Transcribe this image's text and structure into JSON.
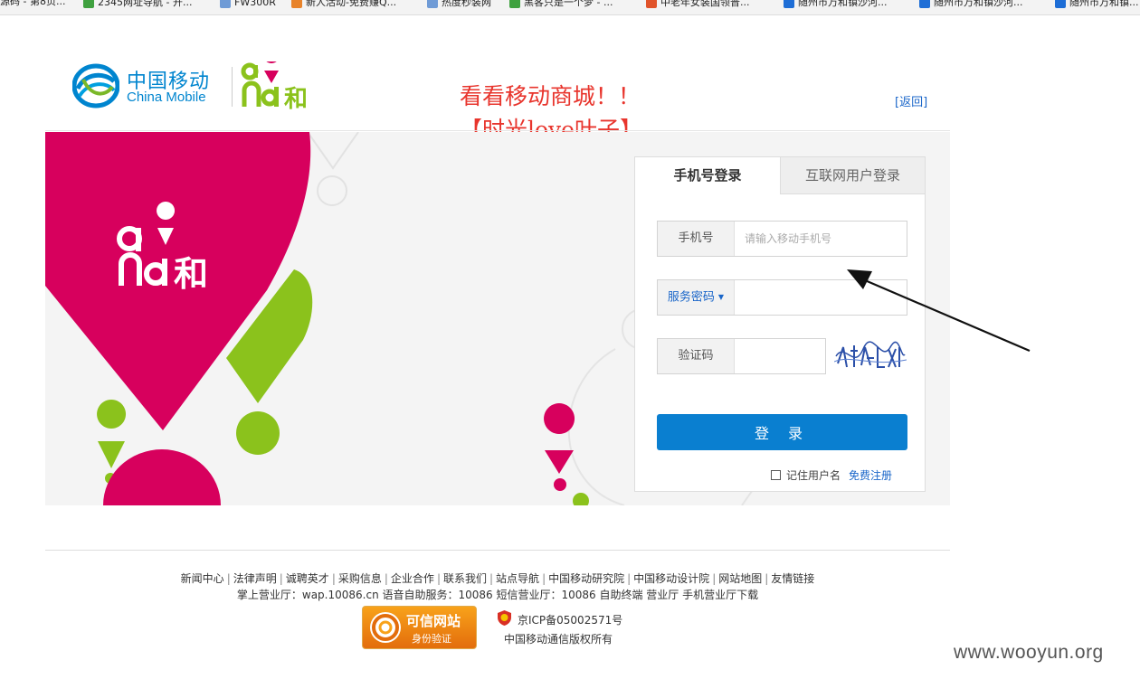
{
  "bookmarks": [
    {
      "label": "源码 - 第8页...",
      "icon_color": "#c8c8c8",
      "icon": "page-icon"
    },
    {
      "label": "2345网址导航 - 开...",
      "icon_color": "#3fa13f",
      "icon": "globe-icon"
    },
    {
      "label": "FW300R",
      "icon_color": "#6f9bd6",
      "icon": "ie-icon"
    },
    {
      "label": "新人活动-免费赚Q...",
      "icon_color": "#e8832a",
      "icon": "b-icon"
    },
    {
      "label": "热度秒装网",
      "icon_color": "#6f9bd6",
      "icon": "ie-icon"
    },
    {
      "label": "黑客只是一个梦 - ...",
      "icon_color": "#3fa13f",
      "icon": "s-icon"
    },
    {
      "label": "中老年女装国领普...",
      "icon_color": "#e0532a",
      "icon": "tao-icon"
    },
    {
      "label": "随州市万和镇沙河...",
      "icon_color": "#1e6ed6",
      "icon": "play-icon"
    },
    {
      "label": "随州市万和镇沙河...",
      "icon_color": "#1e6ed6",
      "icon": "play-icon"
    },
    {
      "label": "随州市万和镇...",
      "icon_color": "#1e6ed6",
      "icon": "play-icon"
    }
  ],
  "header": {
    "logo_cn": "中国移动",
    "logo_en": "China Mobile",
    "logo_and": "和",
    "promo_line1": "看看移动商城！！",
    "promo_line2": "【时光love叶子】",
    "return_link": "[返回]"
  },
  "banner": {
    "brand_text": "和",
    "colors": {
      "magenta": "#d7005d",
      "green": "#8bc21c",
      "bg": "#f4f4f4"
    }
  },
  "login": {
    "tab_phone": "手机号登录",
    "tab_internet": "互联网用户登录",
    "phone_label": "手机号",
    "phone_placeholder": "请输入移动手机号",
    "password_label": "服务密码",
    "password_caret": "▼",
    "captcha_label": "验证码",
    "submit": "登 录",
    "remember": "记住用户名",
    "register": "免费注册",
    "accent": "#0a7fd0"
  },
  "footer": {
    "links": [
      "新闻中心",
      "法律声明",
      "诚聘英才",
      "采购信息",
      "企业合作",
      "联系我们",
      "站点导航",
      "中国移动研究院",
      "中国移动设计院",
      "网站地图",
      "友情链接"
    ],
    "separator": "|",
    "info": "掌上营业厅：wap.10086.cn 语音自助服务：10086 短信营业厅：10086 自助终端 营业厅 手机营业厅下载",
    "trust_title": "可信网站",
    "trust_sub": "身份验证",
    "icp": "京ICP备05002571号",
    "copyright": "中国移动通信版权所有"
  },
  "watermark": "www.wooyun.org"
}
